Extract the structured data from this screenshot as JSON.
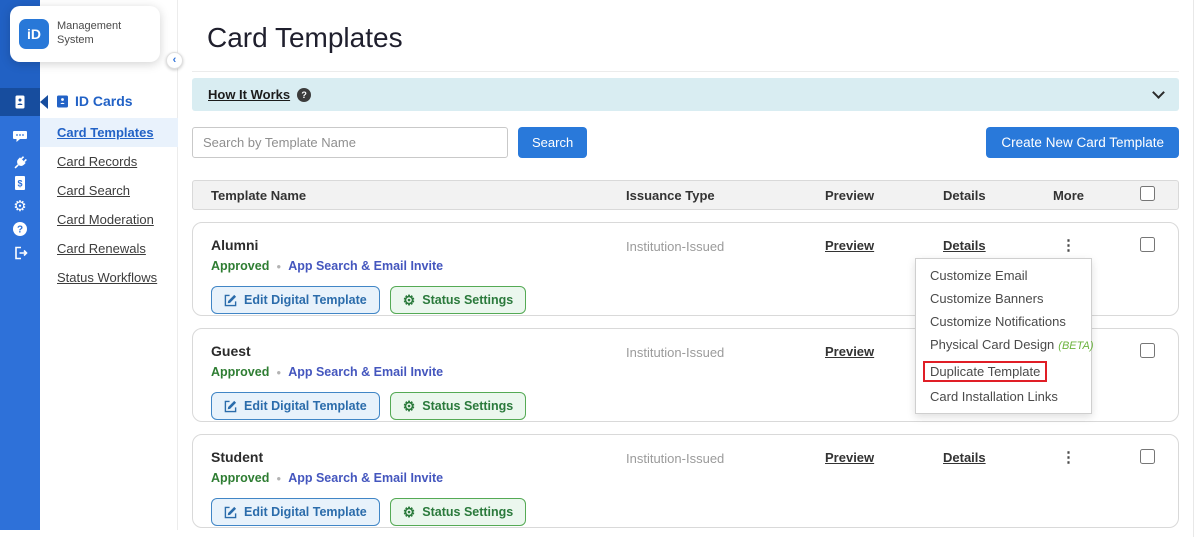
{
  "brand": {
    "logo_text": "iD",
    "name_line1": "Management",
    "name_line2": "System"
  },
  "icons": {
    "collapse": "‹",
    "help_q": "?",
    "kebab": "⋮",
    "gear": "⚙",
    "dot": "●"
  },
  "rail": {
    "items": [
      {
        "name": "id-card",
        "active": true
      },
      {
        "name": "chat"
      },
      {
        "name": "plug"
      },
      {
        "name": "invoice"
      },
      {
        "name": "gear"
      },
      {
        "name": "help"
      },
      {
        "name": "logout"
      }
    ]
  },
  "sidebar": {
    "section_label": "ID Cards",
    "items": [
      {
        "label": "Card Templates",
        "active": true
      },
      {
        "label": "Card Records"
      },
      {
        "label": "Card Search"
      },
      {
        "label": "Card Moderation"
      },
      {
        "label": "Card Renewals"
      },
      {
        "label": "Status Workflows"
      }
    ]
  },
  "header": {
    "title": "Card Templates"
  },
  "how_it_works": {
    "label": "How It Works"
  },
  "toolbar": {
    "search_placeholder": "Search by Template Name",
    "search_button": "Search",
    "create_button": "Create New Card Template"
  },
  "table": {
    "columns": [
      "Template Name",
      "Issuance Type",
      "Preview",
      "Details",
      "More"
    ],
    "labels": {
      "preview": "Preview",
      "details": "Details"
    },
    "row_buttons": {
      "edit": "Edit Digital Template",
      "settings": "Status Settings"
    },
    "rows": [
      {
        "name": "Alumni",
        "status": "Approved",
        "distribution": "App Search & Email Invite",
        "issuance": "Institution-Issued"
      },
      {
        "name": "Guest",
        "status": "Approved",
        "distribution": "App Search & Email Invite",
        "issuance": "Institution-Issued"
      },
      {
        "name": "Student",
        "status": "Approved",
        "distribution": "App Search & Email Invite",
        "issuance": "Institution-Issued"
      }
    ]
  },
  "menu": {
    "items": [
      {
        "label": "Customize Email"
      },
      {
        "label": "Customize Banners"
      },
      {
        "label": "Customize Notifications"
      },
      {
        "label": "Physical Card Design",
        "badge": "(BETA)"
      },
      {
        "label": "Duplicate Template",
        "highlighted": true
      },
      {
        "label": "Card Installation Links"
      }
    ]
  },
  "colors": {
    "rail_blue": "#2e71d9",
    "rail_active": "#174d9e",
    "accent_blue": "#2979da",
    "active_nav_bg": "#e9f2fc",
    "how_bar_bg": "#d9edf2",
    "approved_green": "#2e7d32",
    "distribution_blue": "#4456be",
    "beta_green": "#6cb33f",
    "highlight_red": "#e01e26"
  }
}
